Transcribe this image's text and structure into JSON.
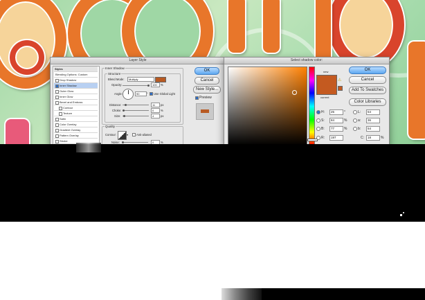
{
  "layer_style": {
    "title": "Layer Style",
    "styles_header": "Styles",
    "items": [
      {
        "label": "Blending Options: Custom",
        "checkbox": false,
        "checked": false,
        "active": false
      },
      {
        "label": "Drop Shadow",
        "checkbox": true,
        "checked": false,
        "active": false
      },
      {
        "label": "Inner Shadow",
        "checkbox": true,
        "checked": true,
        "active": true
      },
      {
        "label": "Outer Glow",
        "checkbox": true,
        "checked": false,
        "active": false
      },
      {
        "label": "Inner Glow",
        "checkbox": true,
        "checked": false,
        "active": false
      },
      {
        "label": "Bevel and Emboss",
        "checkbox": true,
        "checked": false,
        "active": false
      },
      {
        "label": "Contour",
        "checkbox": true,
        "checked": false,
        "active": false
      },
      {
        "label": "Texture",
        "checkbox": true,
        "checked": false,
        "active": false
      },
      {
        "label": "Satin",
        "checkbox": true,
        "checked": false,
        "active": false
      },
      {
        "label": "Color Overlay",
        "checkbox": true,
        "checked": false,
        "active": false
      },
      {
        "label": "Gradient Overlay",
        "checkbox": true,
        "checked": false,
        "active": false
      },
      {
        "label": "Pattern Overlay",
        "checkbox": true,
        "checked": false,
        "active": false
      },
      {
        "label": "Stroke",
        "checkbox": true,
        "checked": false,
        "active": false
      }
    ],
    "section_title": "Inner Shadow",
    "structure_legend": "Structure",
    "blend_mode_label": "Blend Mode:",
    "blend_mode_value": "Multiply",
    "opacity_label": "Opacity:",
    "opacity_value": "100",
    "opacity_unit": "%",
    "angle_label": "Angle:",
    "angle_value": "90",
    "angle_unit": "°",
    "global_light_label": "Use Global Light",
    "distance_label": "Distance:",
    "distance_value": "11",
    "distance_unit": "px",
    "choke_label": "Choke:",
    "choke_value": "0",
    "choke_unit": "%",
    "size_label": "Size:",
    "size_value": "4",
    "size_unit": "px",
    "quality_legend": "Quality",
    "contour_label": "Contour:",
    "anti_aliased_label": "Anti-aliased",
    "noise_label": "Noise:",
    "noise_value": "0",
    "noise_unit": "%",
    "ok_label": "OK",
    "cancel_label": "Cancel",
    "new_style_label": "New Style...",
    "preview_label": "Preview",
    "shadow_color": "#b85a22"
  },
  "color_picker": {
    "title": "Select shadow color:",
    "ok_label": "OK",
    "cancel_label": "Cancel",
    "add_swatches_label": "Add To Swatches",
    "color_libraries_label": "Color Libraries",
    "new_label": "new",
    "current_label": "current",
    "hue_color": "#ff8000",
    "selected_color": "#c45a20",
    "fields": {
      "H": {
        "label": "H:",
        "value": "25",
        "unit": "°"
      },
      "S": {
        "label": "S:",
        "value": "84",
        "unit": "%"
      },
      "B": {
        "label": "B:",
        "value": "77",
        "unit": "%"
      },
      "R": {
        "label": "R:",
        "value": "197"
      },
      "L": {
        "label": "L:",
        "value": "54"
      },
      "a": {
        "label": "a:",
        "value": "36"
      },
      "b": {
        "label": "b:",
        "value": "54"
      },
      "C": {
        "label": "C:",
        "value": "18",
        "unit": "%"
      }
    }
  },
  "artwork_colors": {
    "orange": "#e8762a",
    "red": "#d9442c",
    "cream": "#f6d49a",
    "pink": "#e85a7a",
    "green": "#9fd7a5"
  }
}
